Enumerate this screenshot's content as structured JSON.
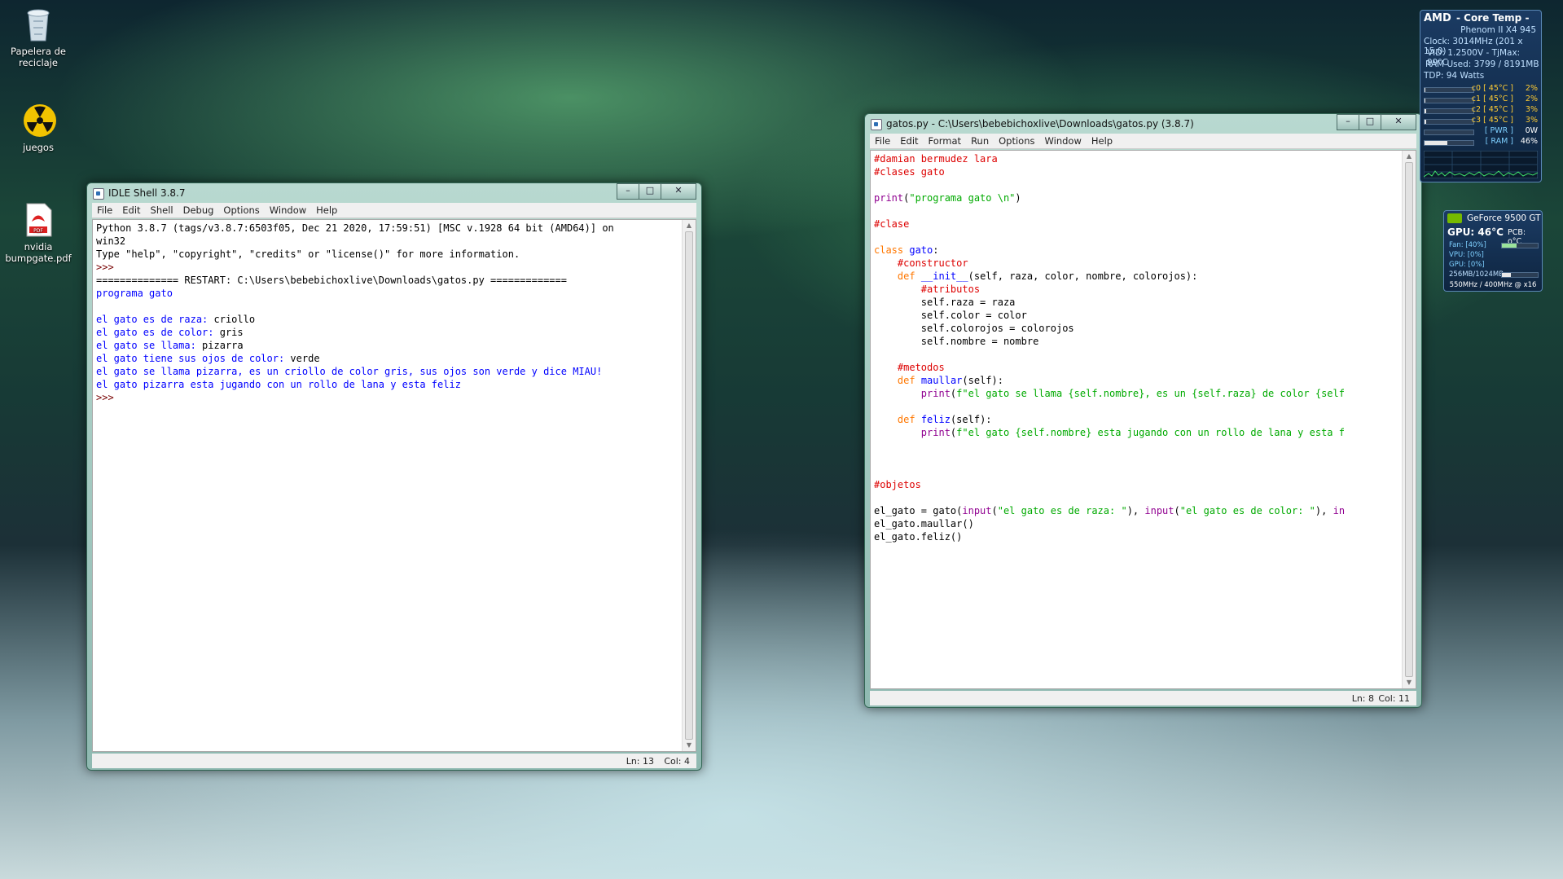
{
  "desktop": {
    "icons": [
      {
        "label": "Papelera de reciclaje",
        "icon": "recycle-bin-icon"
      },
      {
        "label": "juegos",
        "icon": "radiation-folder-icon"
      },
      {
        "label": "nvidia bumpgate.pdf",
        "icon": "pdf-file-icon"
      }
    ]
  },
  "shell": {
    "title": "IDLE Shell 3.8.7",
    "menu": [
      "File",
      "Edit",
      "Shell",
      "Debug",
      "Options",
      "Window",
      "Help"
    ],
    "lines": [
      {
        "text": "Python 3.8.7 (tags/v3.8.7:6503f05, Dec 21 2020, 17:59:51) [MSC v.1928 64 bit (AMD64)] on",
        "kind": "plain"
      },
      {
        "text": "win32",
        "kind": "plain"
      },
      {
        "text": "Type \"help\", \"copyright\", \"credits\" or \"license()\" for more information.",
        "kind": "plain"
      },
      {
        "text": ">>>",
        "kind": "prompt"
      },
      {
        "text": "============== RESTART: C:\\Users\\bebebichoxlive\\Downloads\\gatos.py =============",
        "kind": "plain"
      },
      {
        "text": "programa gato",
        "kind": "out"
      },
      {
        "text": "",
        "kind": "out"
      },
      {
        "text": "el gato es de raza: ",
        "input": "criollo",
        "kind": "ask"
      },
      {
        "text": "el gato es de color: ",
        "input": "gris",
        "kind": "ask"
      },
      {
        "text": "el gato se llama: ",
        "input": "pizarra",
        "kind": "ask"
      },
      {
        "text": "el gato tiene sus ojos de color: ",
        "input": "verde",
        "kind": "ask"
      },
      {
        "text": "el gato se llama pizarra, es un criollo de color gris, sus ojos son verde y dice MIAU!",
        "kind": "out"
      },
      {
        "text": "el gato pizarra esta jugando con un rollo de lana y esta feliz",
        "kind": "out"
      },
      {
        "text": ">>>",
        "kind": "prompt"
      }
    ],
    "status": {
      "ln": "Ln: 13",
      "col": "Col: 4"
    }
  },
  "editor": {
    "title": "gatos.py - C:\\Users\\bebebichoxlive\\Downloads\\gatos.py (3.8.7)",
    "menu": [
      "File",
      "Edit",
      "Format",
      "Run",
      "Options",
      "Window",
      "Help"
    ],
    "lines": [
      [
        {
          "t": "#damian bermudez lara",
          "c": "c"
        }
      ],
      [
        {
          "t": "#clases gato",
          "c": "c"
        }
      ],
      [],
      [
        {
          "t": "print",
          "c": "b"
        },
        {
          "t": "(",
          "c": ""
        },
        {
          "t": "\"programa gato \\n\"",
          "c": "s"
        },
        {
          "t": ")",
          "c": ""
        }
      ],
      [],
      [
        {
          "t": "#clase",
          "c": "c"
        }
      ],
      [],
      [
        {
          "t": "class",
          "c": "k"
        },
        {
          "t": " ",
          "c": ""
        },
        {
          "t": "gato",
          "c": "d"
        },
        {
          "t": ":",
          "c": ""
        }
      ],
      [
        {
          "t": "    ",
          "c": ""
        },
        {
          "t": "#constructor",
          "c": "c"
        }
      ],
      [
        {
          "t": "    ",
          "c": ""
        },
        {
          "t": "def",
          "c": "k"
        },
        {
          "t": " ",
          "c": ""
        },
        {
          "t": "__init__",
          "c": "d"
        },
        {
          "t": "(self, raza, color, nombre, colorojos):",
          "c": ""
        }
      ],
      [
        {
          "t": "        ",
          "c": ""
        },
        {
          "t": "#atributos",
          "c": "c"
        }
      ],
      [
        {
          "t": "        self.raza = raza",
          "c": ""
        }
      ],
      [
        {
          "t": "        self.color = color",
          "c": ""
        }
      ],
      [
        {
          "t": "        self.colorojos = colorojos",
          "c": ""
        }
      ],
      [
        {
          "t": "        self.nombre = nombre",
          "c": ""
        }
      ],
      [],
      [
        {
          "t": "    ",
          "c": ""
        },
        {
          "t": "#metodos",
          "c": "c"
        }
      ],
      [
        {
          "t": "    ",
          "c": ""
        },
        {
          "t": "def",
          "c": "k"
        },
        {
          "t": " ",
          "c": ""
        },
        {
          "t": "maullar",
          "c": "d"
        },
        {
          "t": "(self):",
          "c": ""
        }
      ],
      [
        {
          "t": "        ",
          "c": ""
        },
        {
          "t": "print",
          "c": "b"
        },
        {
          "t": "(",
          "c": ""
        },
        {
          "t": "f\"el gato se llama {self.nombre}, es un {self.raza} de color {self",
          "c": "s"
        }
      ],
      [],
      [
        {
          "t": "    ",
          "c": ""
        },
        {
          "t": "def",
          "c": "k"
        },
        {
          "t": " ",
          "c": ""
        },
        {
          "t": "feliz",
          "c": "d"
        },
        {
          "t": "(self):",
          "c": ""
        }
      ],
      [
        {
          "t": "        ",
          "c": ""
        },
        {
          "t": "print",
          "c": "b"
        },
        {
          "t": "(",
          "c": ""
        },
        {
          "t": "f\"el gato {self.nombre} esta jugando con un rollo de lana y esta f",
          "c": "s"
        }
      ],
      [],
      [],
      [],
      [
        {
          "t": "#objetos",
          "c": "c"
        }
      ],
      [],
      [
        {
          "t": "el_gato = gato(",
          "c": ""
        },
        {
          "t": "input",
          "c": "b"
        },
        {
          "t": "(",
          "c": ""
        },
        {
          "t": "\"el gato es de raza: \"",
          "c": "s"
        },
        {
          "t": "), ",
          "c": ""
        },
        {
          "t": "input",
          "c": "b"
        },
        {
          "t": "(",
          "c": ""
        },
        {
          "t": "\"el gato es de color: \"",
          "c": "s"
        },
        {
          "t": "), ",
          "c": ""
        },
        {
          "t": "in",
          "c": "b"
        }
      ],
      [
        {
          "t": "el_gato.maullar()",
          "c": ""
        }
      ],
      [
        {
          "t": "el_gato.feliz()",
          "c": ""
        }
      ]
    ],
    "status": {
      "ln": "Ln: 8",
      "col": "Col: 11"
    }
  },
  "core_temp": {
    "brand": "AMD",
    "title": "- Core Temp -",
    "cpu": "Phenom II X4 945",
    "clock": "Clock: 3014MHz (201 x 15.0)",
    "vid": "VID: 1.2500V - TjMax: 99°C",
    "ram": "RAM Used: 3799 / 8191MB",
    "tdp": "TDP: 94 Watts",
    "cores": [
      {
        "label": "c0 [ 45°C ]",
        "value": "2%",
        "level": 0.02
      },
      {
        "label": "c1 [ 45°C ]",
        "value": "2%",
        "level": 0.02
      },
      {
        "label": "c2 [ 45°C ]",
        "value": "3%",
        "level": 0.03
      },
      {
        "label": "c3 [ 45°C ]",
        "value": "3%",
        "level": 0.03
      },
      {
        "label": "[ PWR ]",
        "value": "0W",
        "level": 0.0
      },
      {
        "label": "[ RAM ]",
        "value": "46%",
        "level": 0.46
      }
    ]
  },
  "gpu": {
    "name": "GeForce 9500 GT",
    "temp": "GPU: 46°C",
    "pcb": "PCB: o°C",
    "fan": "Fan: [40%]",
    "fan_level": 0.4,
    "vpu": "VPU: [0%]",
    "gpu_load": "GPU: [0%]",
    "mem": "256MB/1024MB",
    "mem_level": 0.25,
    "clocks": "550MHz / 400MHz @ x16"
  }
}
